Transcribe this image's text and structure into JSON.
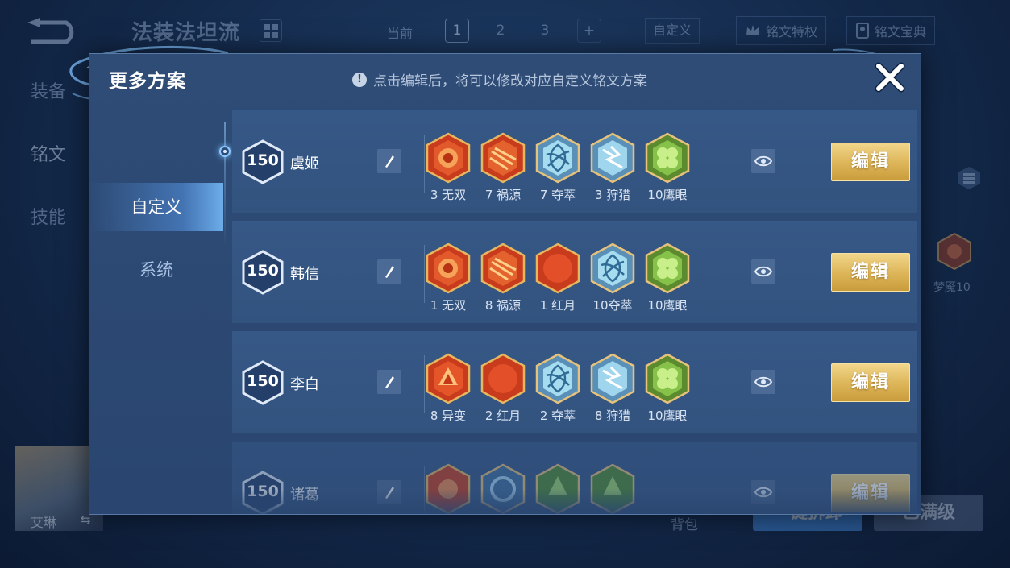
{
  "background": {
    "page_title": "法装法坦流",
    "current_label": "当前",
    "page_tabs": [
      "1",
      "2",
      "3",
      "+"
    ],
    "custom_label": "自定义",
    "privilege_label": "铭文特权",
    "codex_label": "铭文宝典",
    "side_tabs": [
      "装备",
      "铭文",
      "技能"
    ],
    "hero_name": "艾琳",
    "hero_swap": "⇆",
    "bag_label": "背包",
    "one_click_label": "一键拆卸",
    "max_level_label": "已满级",
    "dream_label": "梦魇10"
  },
  "modal": {
    "title": "更多方案",
    "hint_icon": "!",
    "hint": "点击编辑后，将可以修改对应自定义铭文方案",
    "nav": [
      "自定义",
      "系统"
    ],
    "edit_label": "编辑",
    "plans": [
      {
        "level": "150",
        "hero": "虞姬",
        "runes": [
          {
            "label": "3 无双",
            "icon": "red-wushuang"
          },
          {
            "label": "7 祸源",
            "icon": "red-huoyuan"
          },
          {
            "label": "7 夺萃",
            "icon": "blue-duocui"
          },
          {
            "label": "3 狩猎",
            "icon": "blue-shoulie"
          },
          {
            "label": "10鹰眼",
            "icon": "green-yingyan"
          }
        ]
      },
      {
        "level": "150",
        "hero": "韩信",
        "runes": [
          {
            "label": "1 无双",
            "icon": "red-wushuang"
          },
          {
            "label": "8 祸源",
            "icon": "red-huoyuan"
          },
          {
            "label": "1 红月",
            "icon": "red-hongyue"
          },
          {
            "label": "10夺萃",
            "icon": "blue-duocui"
          },
          {
            "label": "10鹰眼",
            "icon": "green-yingyan"
          }
        ]
      },
      {
        "level": "150",
        "hero": "李白",
        "runes": [
          {
            "label": "8 异变",
            "icon": "red-yibian"
          },
          {
            "label": "2 红月",
            "icon": "red-hongyue"
          },
          {
            "label": "2 夺萃",
            "icon": "blue-duocui"
          },
          {
            "label": "8 狩猎",
            "icon": "blue-shoulie"
          },
          {
            "label": "10鹰眼",
            "icon": "green-yingyan"
          }
        ]
      },
      {
        "level": "150",
        "hero": "诸葛",
        "runes": [
          {
            "label": "",
            "icon": "red-partial"
          },
          {
            "label": "",
            "icon": "blue-partial"
          },
          {
            "label": "",
            "icon": "green-partial"
          },
          {
            "label": "",
            "icon": "green-partial"
          }
        ]
      }
    ]
  },
  "colors": {
    "modal_bg": "#2e4c76",
    "row_bg": "#365886",
    "edit_gold": "#dcb457",
    "red_rune": "#e0532a",
    "blue_rune": "#8ec9e6",
    "green_rune": "#86c24a"
  }
}
